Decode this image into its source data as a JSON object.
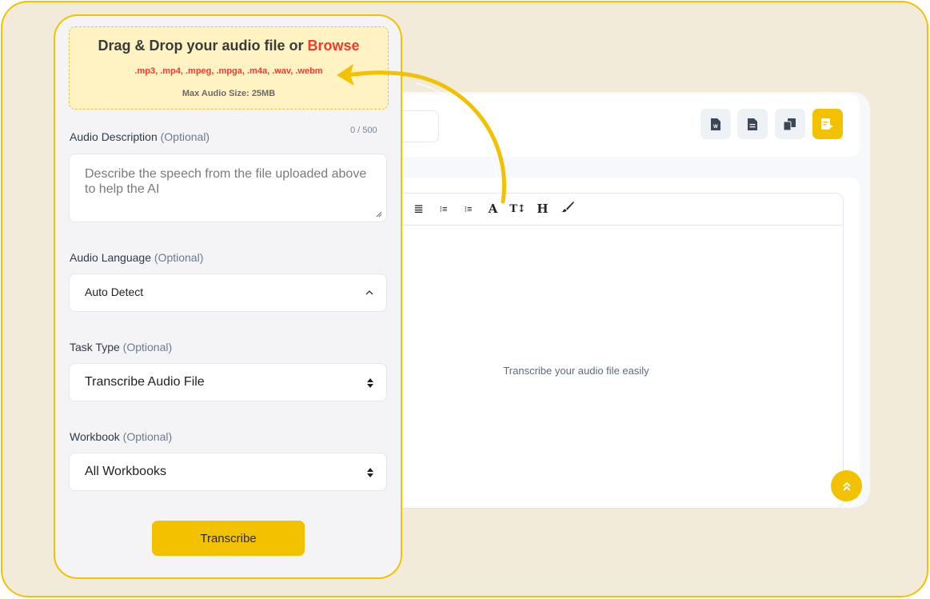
{
  "colors": {
    "accent": "#f2c200",
    "browse": "#f23a2f",
    "frame_bg": "#f3ebd9"
  },
  "dropzone": {
    "title": "Drag & Drop your audio file or ",
    "browse": "Browse",
    "formats": ".mp3, .mp4, .mpeg, .mpga, .m4a, .wav, .webm",
    "max_size": "Max Audio Size: 25MB"
  },
  "description": {
    "label": "Audio Description",
    "optional": "(Optional)",
    "counter": "0 / 500",
    "placeholder": "Describe the speech from the file uploaded above to help the AI"
  },
  "language": {
    "label": "Audio Language",
    "optional": "(Optional)",
    "value": "Auto Detect"
  },
  "task": {
    "label": "Task Type",
    "optional": "(Optional)",
    "value": "Transcribe Audio File"
  },
  "workbook": {
    "label": "Workbook",
    "optional": "(Optional)",
    "value": "All Workbooks"
  },
  "submit_label": "Transcribe",
  "editor": {
    "placeholder": "Transcribe your audio file easily",
    "header_buttons": [
      "word-export-icon",
      "document-icon",
      "copy-icon",
      "save-icon"
    ],
    "toolbar": [
      {
        "icon": "align-justify-icon",
        "glyph": "≣"
      },
      {
        "icon": "ordered-list-icon",
        "glyph": "⁝≡"
      },
      {
        "icon": "bullet-list-icon",
        "glyph": "⁝≡"
      },
      {
        "icon": "font-color-icon",
        "glyph": "A"
      },
      {
        "icon": "font-size-icon",
        "glyph": "T↕"
      },
      {
        "icon": "heading-icon",
        "glyph": "H"
      },
      {
        "icon": "brush-icon",
        "glyph": "🖌"
      }
    ]
  }
}
